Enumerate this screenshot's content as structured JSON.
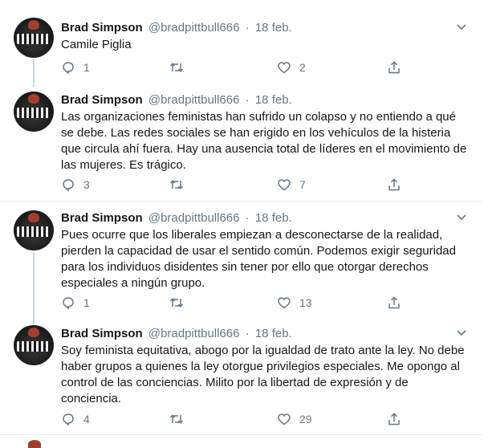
{
  "tweets": [
    {
      "name": "Brad Simpson",
      "handle": "@bradpittbull666",
      "date": "18 feb.",
      "text": "Camile Piglia",
      "replies": "1",
      "retweets": "",
      "likes": "2"
    },
    {
      "name": "Brad Simpson",
      "handle": "@bradpittbull666",
      "date": "18 feb.",
      "text": "Las organizaciones feministas han sufrido un colapso y no entiendo a qué se debe. Las redes sociales se han erigido en los vehículos de la histeria que circula ahí fuera. Hay una ausencia total de líderes en el movimiento de las mujeres. Es trágico.",
      "replies": "3",
      "retweets": "",
      "likes": "7"
    },
    {
      "name": "Brad Simpson",
      "handle": "@bradpittbull666",
      "date": "18 feb.",
      "text": "Pues ocurre que los liberales empiezan a desconectarse de la realidad, pierden la capacidad de usar el sentido común. Podemos exigir seguridad para los individuos disidentes sin tener por ello que otorgar derechos especiales a ningún grupo.",
      "replies": "1",
      "retweets": "",
      "likes": "13"
    },
    {
      "name": "Brad Simpson",
      "handle": "@bradpittbull666",
      "date": "18 feb.",
      "text": "Soy feminista equitativa, abogo por la igualdad de trato ante la ley. No debe haber grupos a quienes la ley otorgue privilegios especiales. Me opongo al control de las conciencias. Milito por la libertad de expresión y de conciencia.",
      "replies": "4",
      "retweets": "",
      "likes": "29"
    }
  ],
  "separator": "·",
  "icons": {
    "reply": "reply-icon",
    "retweet": "retweet-icon",
    "like": "heart-icon",
    "share": "share-icon",
    "more": "chevron-down-icon"
  },
  "colors": {
    "text": "#14171a",
    "muted": "#657786",
    "thread": "#ccd6dd",
    "divider": "#e6ecf0"
  }
}
